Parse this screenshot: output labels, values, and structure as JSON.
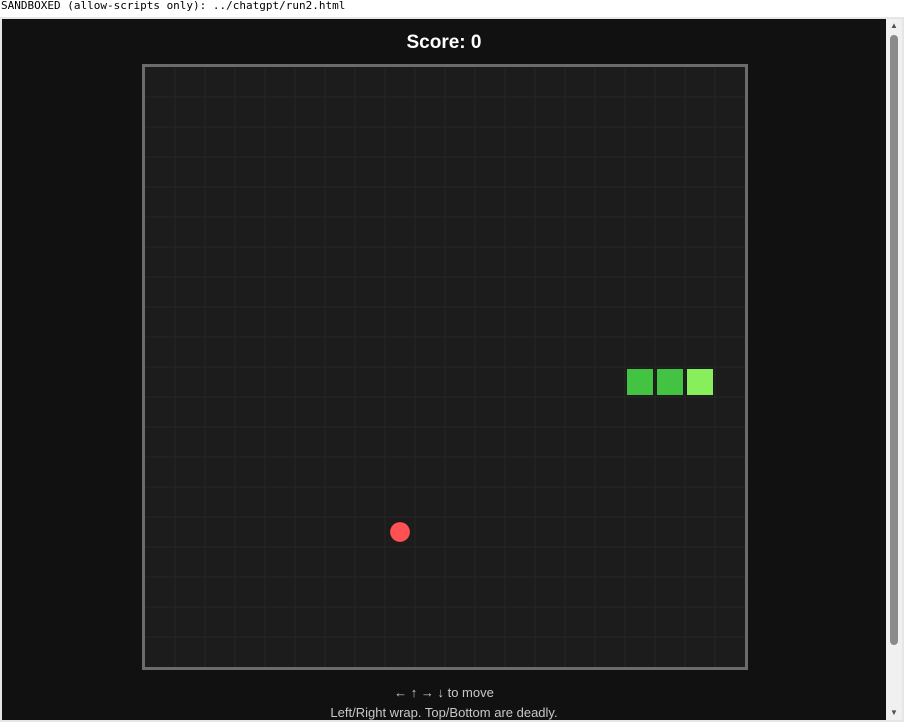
{
  "banner": {
    "text": "SANDBOXED (allow-scripts only): ../chatgpt/run2.html"
  },
  "game": {
    "score_text": "Score: 0",
    "score": 0,
    "grid": {
      "cols": 20,
      "rows": 20
    },
    "snake": [
      {
        "col": 18,
        "row": 10,
        "head": true
      },
      {
        "col": 17,
        "row": 10
      },
      {
        "col": 16,
        "row": 10
      }
    ],
    "food": {
      "col": 8,
      "row": 15
    },
    "colors": {
      "board_bg": "#1c1c1c",
      "grid_line": "#262626",
      "snake_head": "#86ef5b",
      "snake_body": "#42c442",
      "food": "#ff5151"
    }
  },
  "instructions": {
    "controls": "← ↑ → ↓ to move",
    "rules": "Left/Right wrap. Top/Bottom are deadly."
  },
  "scrollbar": {
    "up_icon": "scroll-up-arrow",
    "down_icon": "scroll-down-arrow"
  }
}
